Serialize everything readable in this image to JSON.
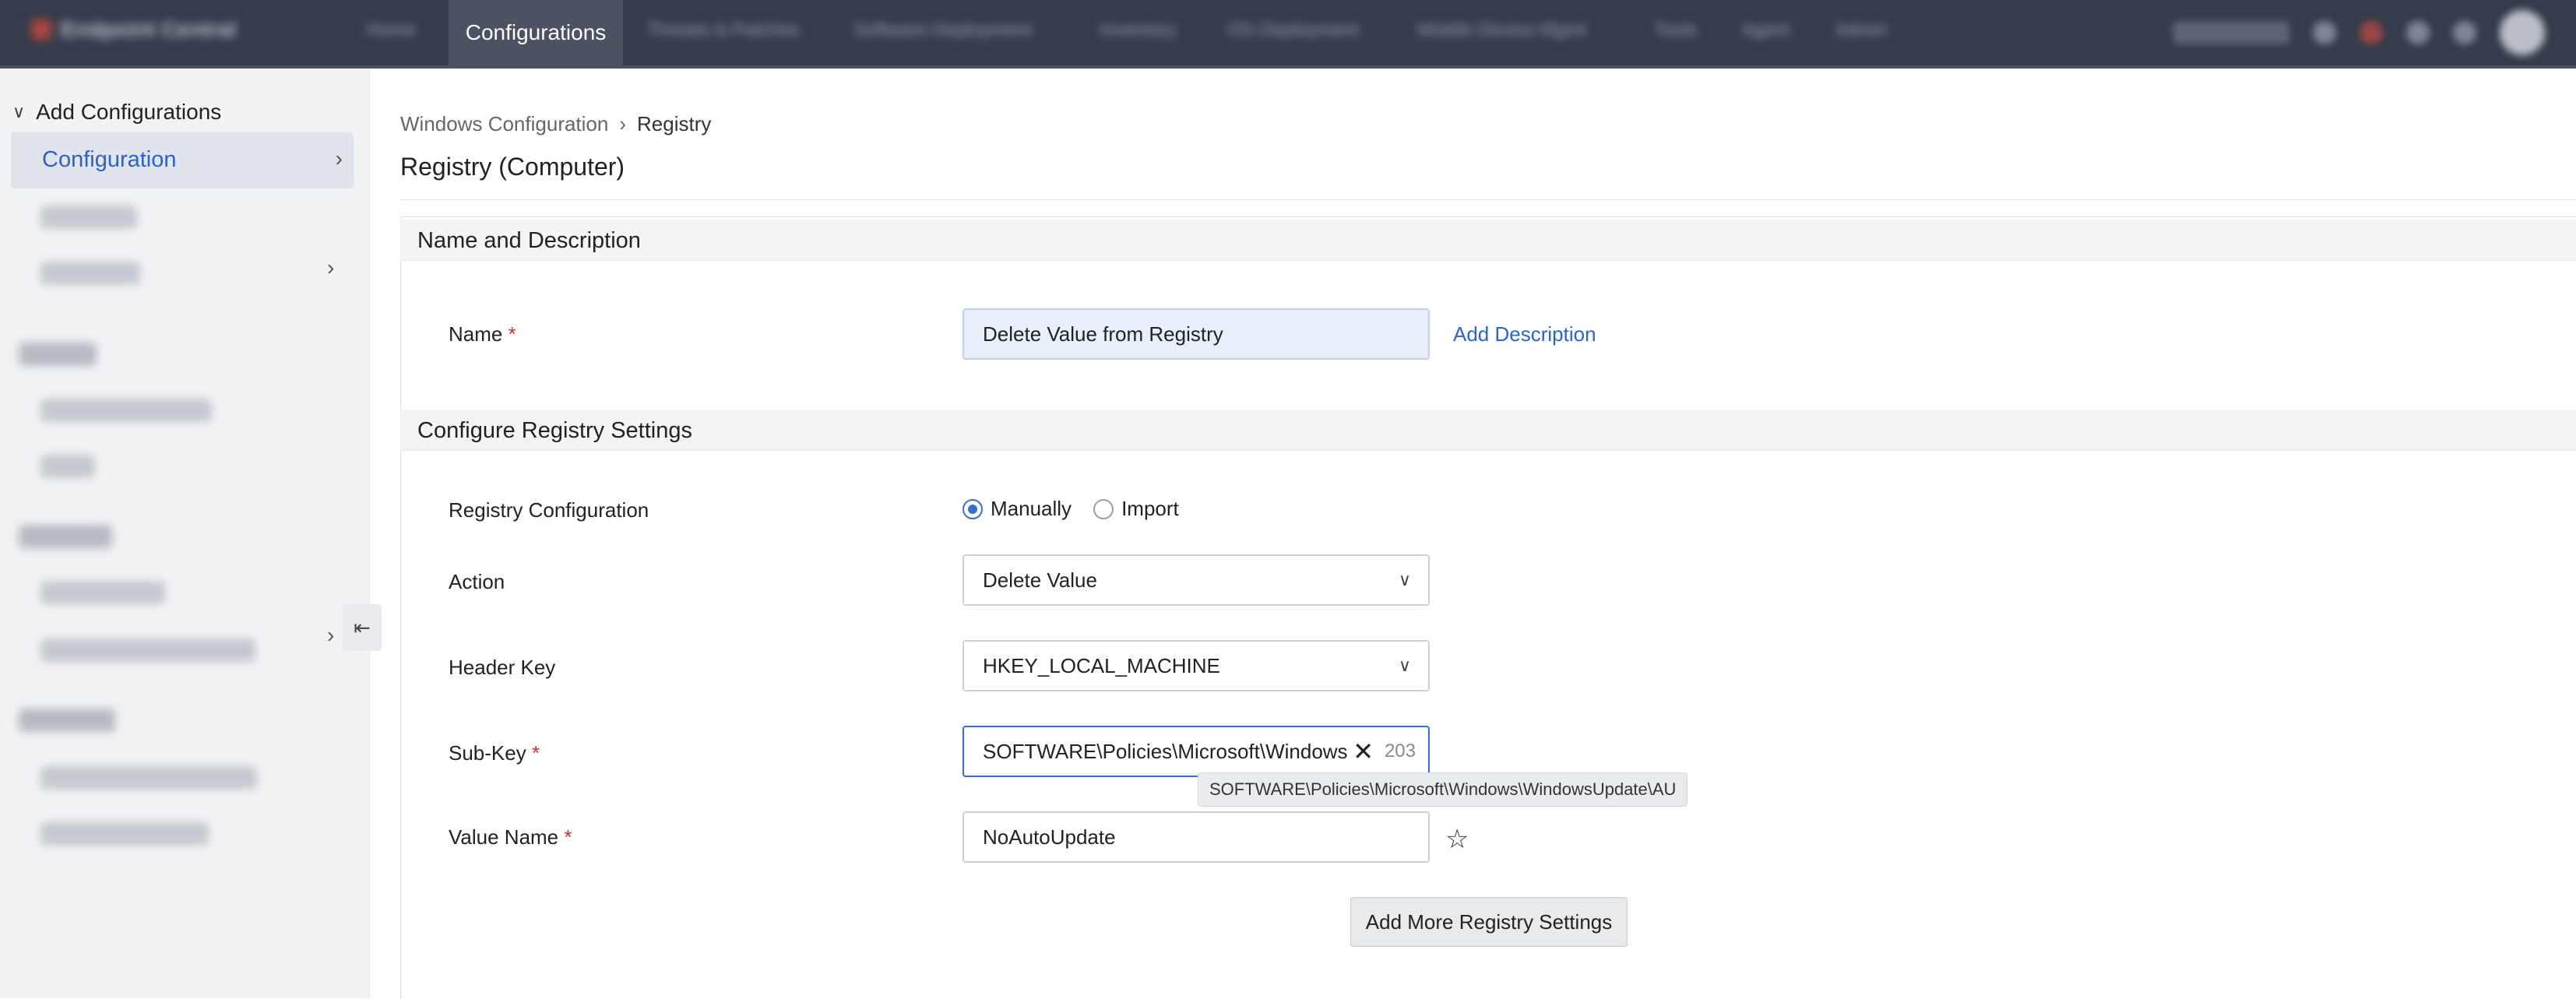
{
  "topbar": {
    "app_name": "Endpoint Central",
    "nav_items": [
      "Home",
      "Configurations",
      "Threats & Patches",
      "Software Deployment",
      "Inventory",
      "OS Deployment",
      "Mobile Device Mgmt",
      "Tools",
      "Agent",
      "Admin"
    ],
    "active_nav": "Configurations",
    "icons": [
      "search-icon",
      "alert-icon",
      "bell-icon",
      "settings-icon",
      "help-icon",
      "user-avatar"
    ]
  },
  "sidebar": {
    "header": "Add Configurations",
    "active_item": "Configuration",
    "collapse_icon": "collapse-sidebar-icon"
  },
  "breadcrumb": {
    "parent": "Windows Configuration",
    "current": "Registry"
  },
  "page": {
    "title": "Registry (Computer)"
  },
  "sections": {
    "name_desc": "Name and Description",
    "registry": "Configure Registry Settings"
  },
  "form": {
    "name_label": "Name",
    "name_value": "Delete Value from Registry",
    "add_description": "Add Description",
    "reg_config_label": "Registry Configuration",
    "radio_manual": "Manually",
    "radio_import": "Import",
    "action_label": "Action",
    "action_value": "Delete Value",
    "header_key_label": "Header Key",
    "header_key_value": "HKEY_LOCAL_MACHINE",
    "subkey_label": "Sub-Key",
    "subkey_value": "SOFTWARE\\Policies\\Microsoft\\Windows",
    "subkey_counter": "203",
    "subkey_tooltip": "SOFTWARE\\Policies\\Microsoft\\Windows\\WindowsUpdate\\AU",
    "value_name_label": "Value Name",
    "value_name_value": "NoAutoUpdate",
    "required_mark": "*",
    "add_more_button": "Add More Registry Settings"
  },
  "colors": {
    "accent": "#2c63c8",
    "topbar": "#343b4a",
    "required": "#d0302e"
  }
}
